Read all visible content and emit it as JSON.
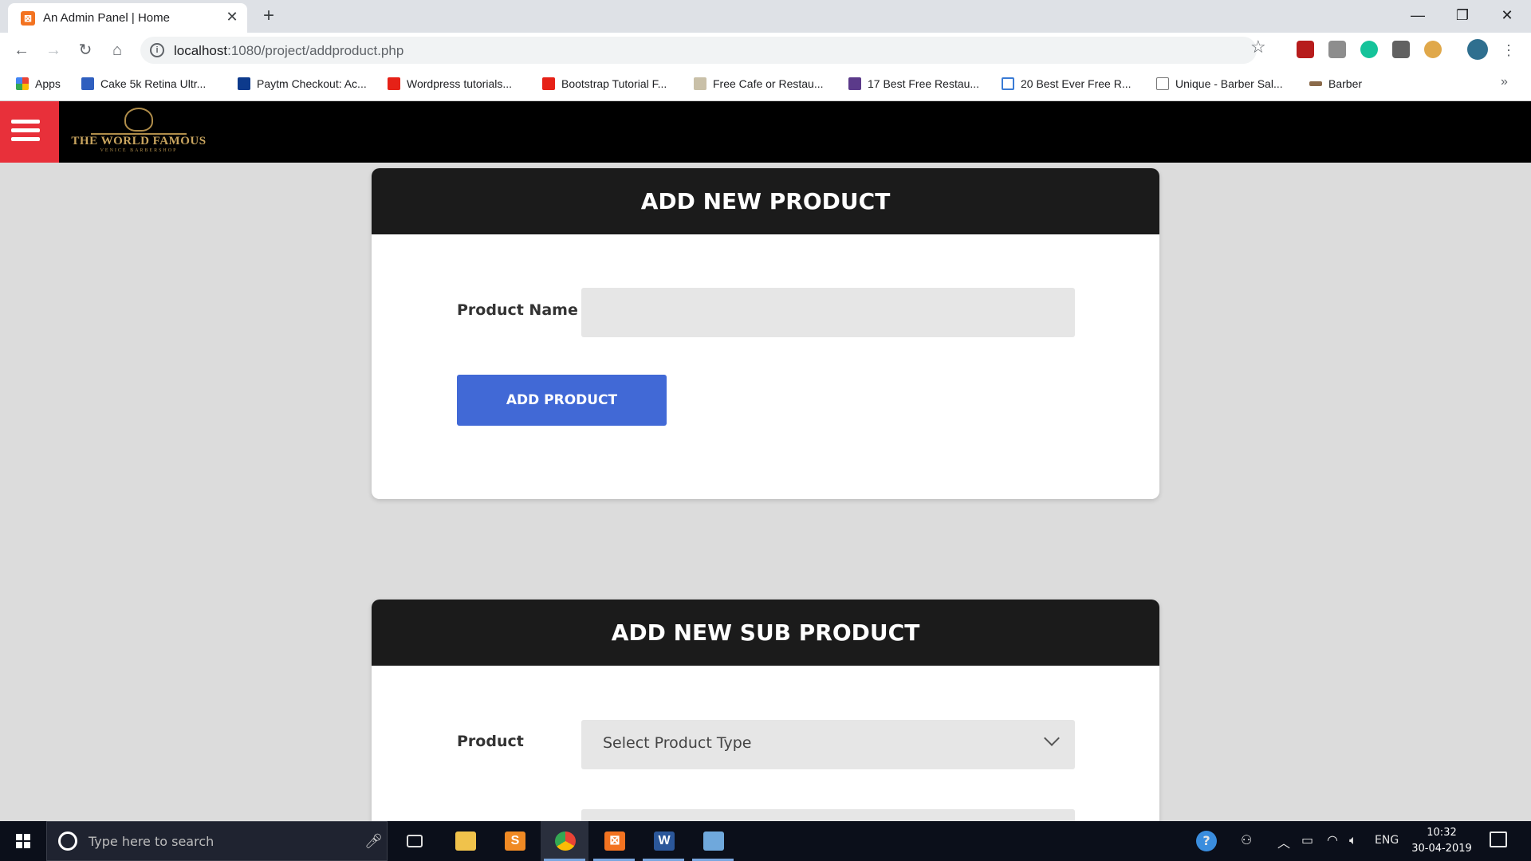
{
  "browser": {
    "tab_title": "An Admin Panel | Home",
    "tab_favicon": "xampp-icon",
    "url_host": "localhost",
    "url_rest": ":1080/project/addproduct.php",
    "bookmarks": [
      "Apps",
      "Cake 5k Retina Ultr...",
      "Paytm Checkout: Ac...",
      "Wordpress tutorials...",
      "Bootstrap Tutorial F...",
      "Free Cafe or Restau...",
      "17 Best Free Restau...",
      "20 Best Ever Free R...",
      "Unique - Barber Sal...",
      "Barber"
    ]
  },
  "page": {
    "logo_text": "THE WORLD FAMOUS",
    "logo_subtext": "VENICE BARBERSHOP",
    "card1": {
      "title": "ADD NEW PRODUCT",
      "product_name_label": "Product Name",
      "product_name_value": "",
      "button_label": "ADD PRODUCT"
    },
    "card2": {
      "title": "ADD NEW SUB PRODUCT",
      "product_label": "Product",
      "product_select_value": "Select Product Type"
    }
  },
  "taskbar": {
    "search_placeholder": "Type here to search",
    "language": "ENG",
    "time": "10:32",
    "date": "30-04-2019"
  },
  "colors": {
    "header_bg": "#1b1b1b",
    "button_bg": "#4169d6",
    "hamburger_bg": "#e8303a"
  }
}
